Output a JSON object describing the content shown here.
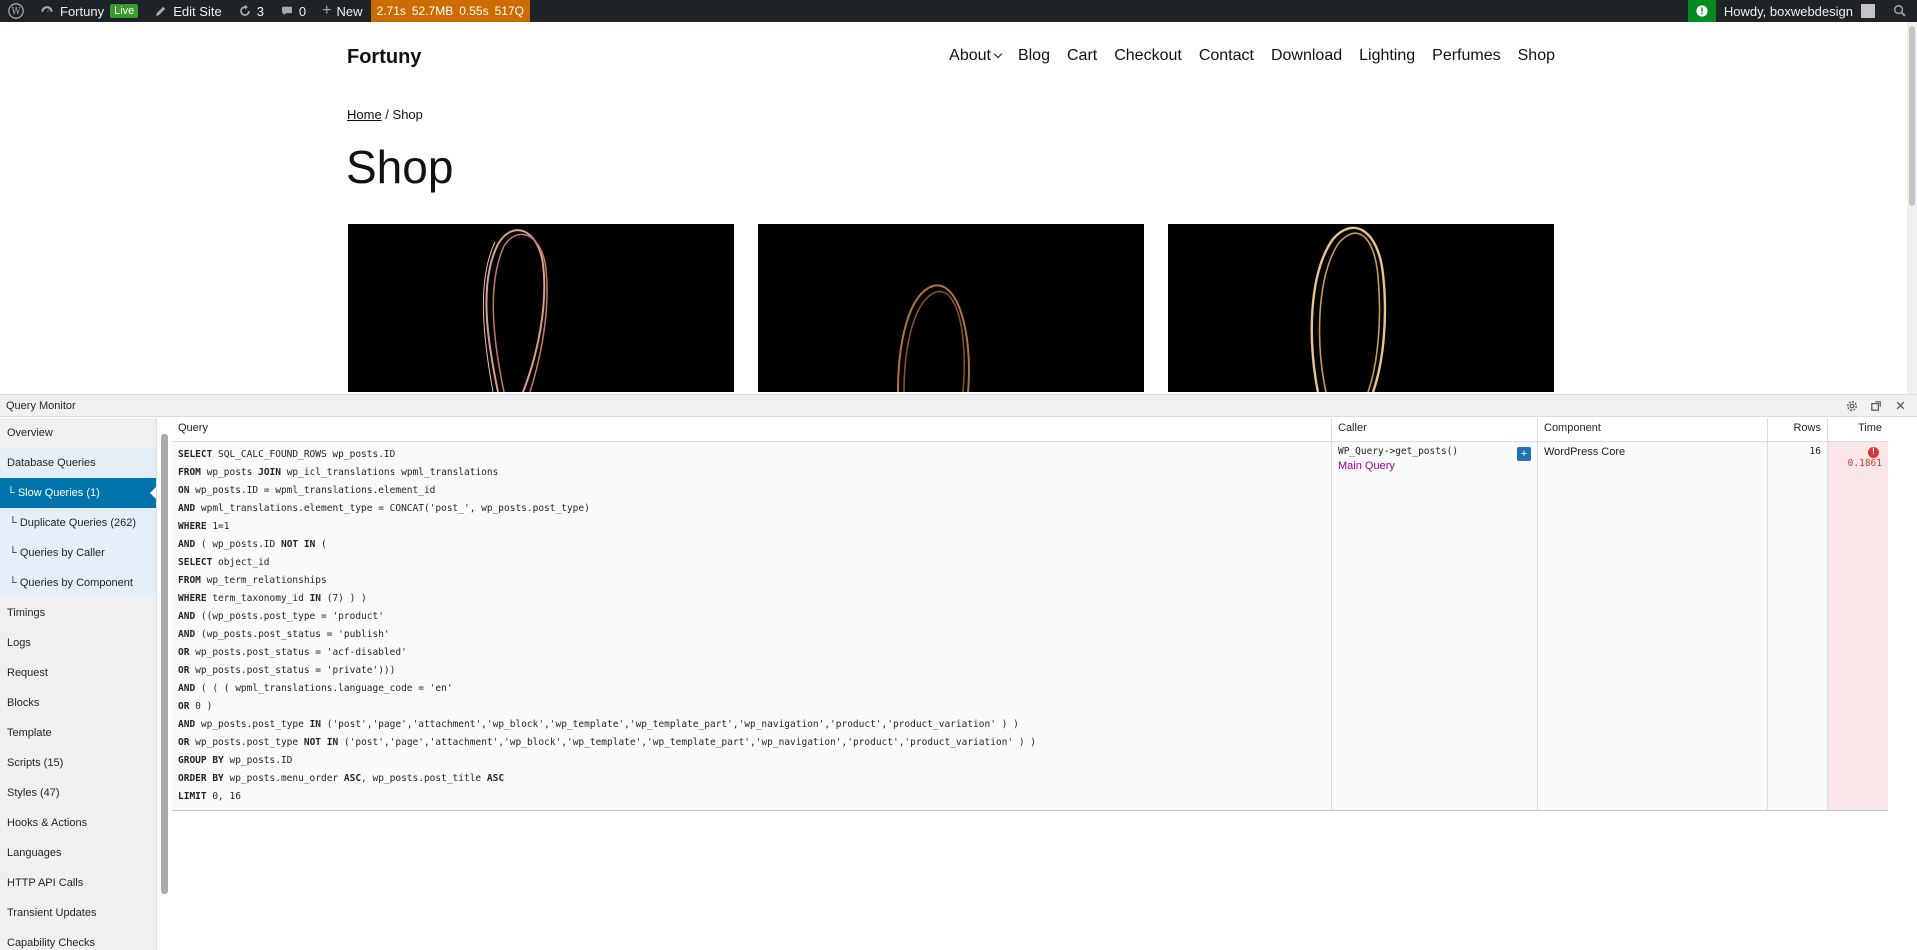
{
  "adminbar": {
    "site_name": "Fortuny",
    "live_badge": "Live",
    "edit_site": "Edit Site",
    "updates_count": "3",
    "comments_count": "0",
    "new_label": "New",
    "perf": [
      "2.71s",
      "52.7MB",
      "0.55s",
      "517Q"
    ],
    "howdy": "Howdy, boxwebdesign"
  },
  "site": {
    "title": "Fortuny",
    "nav": [
      "About",
      "Blog",
      "Cart",
      "Checkout",
      "Contact",
      "Download",
      "Lighting",
      "Perfumes",
      "Shop"
    ],
    "breadcrumb_home": "Home",
    "breadcrumb_sep": " / ",
    "breadcrumb_current": "Shop",
    "page_title": "Shop"
  },
  "qm": {
    "title": "Query Monitor",
    "nav": [
      {
        "label": "Overview",
        "type": "normal"
      },
      {
        "label": "Database Queries",
        "type": "db"
      },
      {
        "label": "└ Slow Queries (1)",
        "type": "active"
      },
      {
        "label": "└ Duplicate Queries (262)",
        "type": "sub"
      },
      {
        "label": "└ Queries by Caller",
        "type": "sub"
      },
      {
        "label": "└ Queries by Component",
        "type": "sub"
      },
      {
        "label": "Timings",
        "type": "normal"
      },
      {
        "label": "Logs",
        "type": "normal"
      },
      {
        "label": "Request",
        "type": "normal"
      },
      {
        "label": "Blocks",
        "type": "normal"
      },
      {
        "label": "Template",
        "type": "normal"
      },
      {
        "label": "Scripts (15)",
        "type": "normal"
      },
      {
        "label": "Styles (47)",
        "type": "normal"
      },
      {
        "label": "Hooks & Actions",
        "type": "normal"
      },
      {
        "label": "Languages",
        "type": "normal"
      },
      {
        "label": "HTTP API Calls",
        "type": "normal"
      },
      {
        "label": "Transient Updates",
        "type": "normal"
      },
      {
        "label": "Capability Checks",
        "type": "normal"
      }
    ],
    "columns": {
      "query": "Query",
      "caller": "Caller",
      "component": "Component",
      "rows": "Rows",
      "time": "Time"
    },
    "row": {
      "sql": [
        "SELECT SQL_CALC_FOUND_ROWS wp_posts.ID",
        "FROM wp_posts JOIN wp_icl_translations wpml_translations",
        "ON wp_posts.ID = wpml_translations.element_id",
        "AND wpml_translations.element_type = CONCAT('post_', wp_posts.post_type)",
        "WHERE 1=1",
        "AND ( wp_posts.ID NOT IN (",
        "SELECT object_id",
        "FROM wp_term_relationships",
        "WHERE term_taxonomy_id IN (7) ) )",
        "AND ((wp_posts.post_type = 'product'",
        "AND (wp_posts.post_status = 'publish'",
        "OR wp_posts.post_status = 'acf-disabled'",
        "OR wp_posts.post_status = 'private')))",
        "AND ( ( ( wpml_translations.language_code = 'en'",
        "OR 0 )",
        "AND wp_posts.post_type IN ('post','page','attachment','wp_block','wp_template','wp_template_part','wp_navigation','product','product_variation' ) )",
        "OR wp_posts.post_type NOT IN ('post','page','attachment','wp_block','wp_template','wp_template_part','wp_navigation','product','product_variation' ) )",
        "GROUP BY wp_posts.ID",
        "ORDER BY wp_posts.menu_order ASC, wp_posts.post_title ASC",
        "LIMIT 0, 16"
      ],
      "caller": "WP_Query->get_posts()",
      "caller_link": "Main Query",
      "expand": "+",
      "component": "WordPress Core",
      "rows": "16",
      "time": "0.1861"
    }
  },
  "colors": {
    "adminbar_bg": "#1d2327",
    "perf_bg": "#cc6c00",
    "qm_active": "#0073aa",
    "slow_time": "#d63638"
  }
}
